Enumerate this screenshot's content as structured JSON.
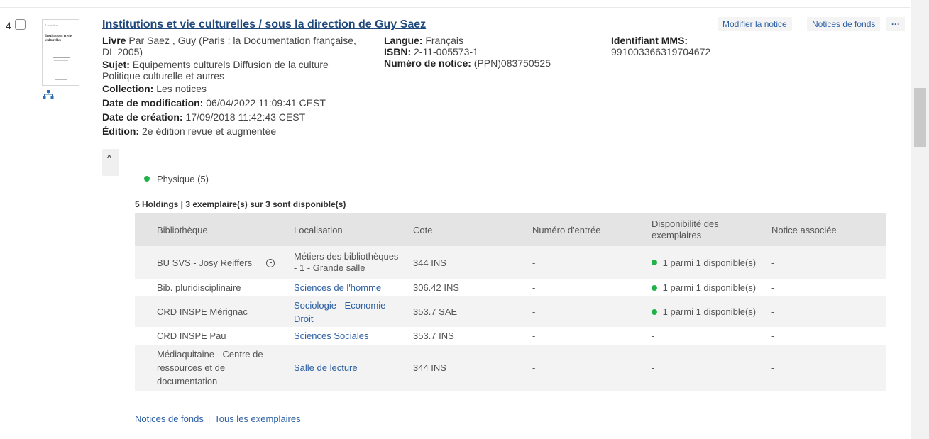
{
  "record": {
    "number": "4",
    "thumbnail": {
      "header": "Les notices",
      "title": "Institutions et vie culturelles"
    },
    "title": "Institutions et vie culturelles / sous la direction de Guy Saez",
    "actions": {
      "edit": "Modifier la notice",
      "holdings": "Notices de fonds",
      "more": "···"
    },
    "col1": {
      "type_label": "Livre",
      "type_value": "Par Saez , Guy (Paris : la Documentation française, DL 2005)",
      "subject_label": "Sujet:",
      "subject_value": "Équipements culturels Diffusion de la culture Politique culturelle et autres",
      "collection_label": "Collection:",
      "collection_value": "Les notices",
      "modified_label": "Date de modification:",
      "modified_value": "06/04/2022 11:09:41 CEST",
      "created_label": "Date de création:",
      "created_value": "17/09/2018 11:42:43 CEST",
      "edition_label": "Édition:",
      "edition_value": "2e édition revue et augmentée"
    },
    "col2": {
      "lang_label": "Langue:",
      "lang_value": "Français",
      "isbn_label": "ISBN:",
      "isbn_value": "2-11-005573-1",
      "notice_label": "Numéro de notice:",
      "notice_value": "(PPN)083750525"
    },
    "col3": {
      "mms_label": "Identifiant MMS:",
      "mms_value": "991003366319704672"
    }
  },
  "holdings": {
    "physical": "Physique (5)",
    "summary": "5 Holdings | 3 exemplaire(s) sur 3 sont disponible(s)",
    "headers": [
      "Bibliothèque",
      "Localisation",
      "Cote",
      "Numéro d'entrée",
      "Disponibilité des exemplaires",
      "Notice associée"
    ],
    "rows": [
      {
        "library": "BU SVS - Josy Reiffers",
        "location": "Métiers des bibliothèques - 1 - Grande salle",
        "call": "344 INS",
        "entry": "-",
        "availability": "1 parmi 1 disponible(s)",
        "assoc": "-"
      },
      {
        "library": "Bib. pluridisciplinaire",
        "location": "Sciences de l'homme",
        "call": "306.42 INS",
        "entry": "-",
        "availability": "1 parmi 1 disponible(s)",
        "assoc": "-"
      },
      {
        "library": "CRD INSPE Mérignac",
        "location": "Sociologie - Economie - Droit",
        "call": "353.7 SAE",
        "entry": "-",
        "availability": "1 parmi 1 disponible(s)",
        "assoc": "-"
      },
      {
        "library": "CRD INSPE Pau",
        "location": "Sciences Sociales",
        "call": "353.7 INS",
        "entry": "-",
        "availability": "-",
        "assoc": "-"
      },
      {
        "library": "Médiaquitaine - Centre de ressources et de documentation",
        "location": "Salle de lecture",
        "call": "344 INS",
        "entry": "-",
        "availability": "-",
        "assoc": "-"
      }
    ]
  },
  "footer": {
    "holdings_link": "Notices de fonds",
    "separator": "|",
    "items_link": "Tous les exemplaires"
  },
  "colors": {
    "title": "#1f497d",
    "link": "#2c5fa3",
    "available": "#21b24a",
    "hierarchy_icon": "#2c6db5"
  }
}
